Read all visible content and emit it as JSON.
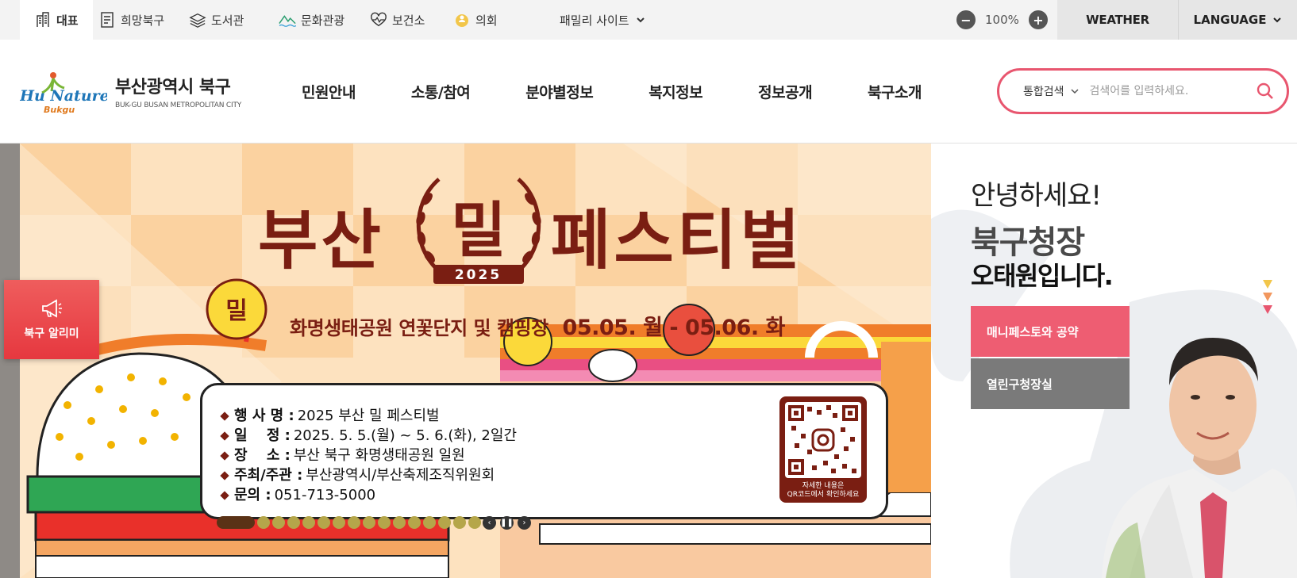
{
  "topbar": {
    "site_tabs": [
      {
        "label": "대표",
        "icon": "building-icon"
      },
      {
        "label": "희망북구",
        "icon": "document-icon"
      },
      {
        "label": "도서관",
        "icon": "books-icon"
      },
      {
        "label": "문화관광",
        "icon": "mountain-icon"
      },
      {
        "label": "보건소",
        "icon": "heartbeat-icon"
      },
      {
        "label": "의회",
        "icon": "council-icon"
      }
    ],
    "family_site": "패밀리 사이트",
    "zoom_level": "100%",
    "weather": "WEATHER",
    "language": "LANGUAGE"
  },
  "header": {
    "logo_brand": "Hu Nature",
    "logo_brand_sub": "Bukgu",
    "logo_title": "부산광역시 북구",
    "logo_subtitle": "BUK-GU BUSAN METROPOLITAN CITY",
    "nav": [
      "민원안내",
      "소통/참여",
      "분야별정보",
      "복지정보",
      "정보공개",
      "북구소개"
    ],
    "search": {
      "scope": "통합검색",
      "placeholder": "검색어를 입력하세요."
    }
  },
  "banner": {
    "title_left": "부산",
    "title_emblem": "밀",
    "title_year": "2025",
    "title_right": "페스티벌",
    "venue": "화명생태공원 연꽃단지 및 캠핑장",
    "dates": "05.05. 월 - 05.06. 화",
    "info": [
      {
        "key": "행 사 명 :",
        "value": "2025 부산 밀 페스티벌"
      },
      {
        "key": "일　 정 :",
        "value": "2025. 5. 5.(월) ~ 5. 6.(화), 2일간"
      },
      {
        "key": "장　 소 :",
        "value": "부산 북구 화명생태공원 일원"
      },
      {
        "key": "주최/주관 :",
        "value": "부산광역시/부산축제조직위원회"
      },
      {
        "key": "문의 :",
        "value": "051-713-5000"
      }
    ],
    "qr_caption_1": "자세한 내용은",
    "qr_caption_2": "QR코드에서 확인하세요",
    "slide_count": 16,
    "active_slide": 1,
    "colors": {
      "accent": "#7a1e12",
      "background": "#fde2bf",
      "checker": "#fbd2a0"
    }
  },
  "side_notice": {
    "label": "북구 알리미",
    "icon": "megaphone-icon"
  },
  "mayor": {
    "greeting": "안녕하세요!",
    "role": "북구청장",
    "name": "오태원입니다.",
    "buttons": [
      "매니페스토와 공약",
      "열린구청장실"
    ],
    "colors": {
      "pink": "#ee5d72",
      "gray": "#7a7a7a"
    }
  }
}
